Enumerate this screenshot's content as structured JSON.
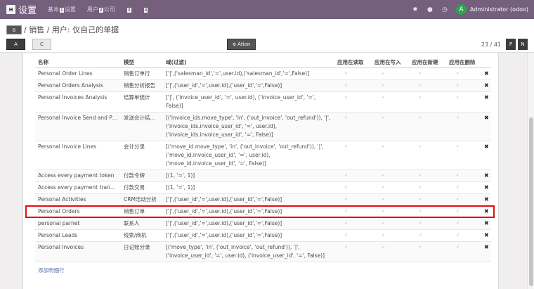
{
  "topbar": {
    "apps_label": "H",
    "brand": "设置",
    "menu": [
      {
        "pre": "基本",
        "box": "1",
        "post": "设置"
      },
      {
        "pre": "用户",
        "box": "2",
        "post": "公司"
      },
      {
        "pre": "",
        "box": "3",
        "post": ""
      },
      {
        "pre": "",
        "box": "4",
        "post": ""
      }
    ],
    "avatar_letter": "A",
    "user": "Administrator (odoo)",
    "accent": "#74607d"
  },
  "breadcrumb": {
    "back_label": "B",
    "path": "/ 销售 / 用户: 仅自己的单据"
  },
  "buttons": {
    "save": "A",
    "discard": "C",
    "action": "A",
    "action_text": "tion"
  },
  "pager": {
    "value": "23 / 41",
    "prev": "P",
    "next": "N"
  },
  "table": {
    "headers": [
      "名称",
      "模型",
      "域(过滤)",
      "应用在读取",
      "应用在写入",
      "应用在新建",
      "应用在删除"
    ],
    "rows": [
      {
        "name": "Personal Order Lines",
        "model": "销售订单行",
        "domain": "['|',('salesman_id','=',user.id),('salesman_id','=',False)]"
      },
      {
        "name": "Personal Orders Analysis",
        "model": "销售分析报告",
        "domain": "['|',('user_id','=',user.id),('user_id','=',False)]"
      },
      {
        "name": "Personal Invoices Analysis",
        "model": "结算单统计",
        "domain": "['|', ('invoice_user_id', '=', user.id), ('invoice_user_id', '=', False)]"
      },
      {
        "name": "Personal Invoice Send and Print",
        "model": "发送会计结算单",
        "domain": "[('invoice_ids.move_type', 'in', ('out_invoice', 'out_refund')), '|', ('invoice_ids.invoice_user_id', '=', user.id), ('invoice_ids.invoice_user_id', '=', False)]"
      },
      {
        "name": "Personal Invoice Lines",
        "model": "会计分录",
        "domain": "[('move_id.move_type', 'in', ('out_invoice', 'out_refund')), '|', ('move_id.invoice_user_id', '=', user.id), ('move_id.invoice_user_id', '=', False)]"
      },
      {
        "name": "Access every payment token",
        "model": "付款令牌",
        "domain": "[(1, '=', 1)]"
      },
      {
        "name": "Access every payment transacti…",
        "model": "付款交易",
        "domain": "[(1, '=', 1)]"
      },
      {
        "name": "Personal Activities",
        "model": "CRM活动分析",
        "domain": "['|',('user_id','=',user.id),('user_id','=',False)]"
      },
      {
        "name": "Personal Orders",
        "model": "销售订单",
        "domain": "['|',('user_id','=',user.id),('user_id','=',False)]"
      },
      {
        "name": "personal parnet",
        "model": "联系人",
        "domain": "['|',('user_id','=',user.id),('user_id','=',False)]"
      },
      {
        "name": "Personal Leads",
        "model": "线索/商机",
        "domain": "['|',('user_id','=',user.id),('user_id','=',False)]"
      },
      {
        "name": "Personal Invoices",
        "model": "日记账分录",
        "domain": "[('move_type', 'in', ('out_invoice', 'out_refund')), '|', ('invoice_user_id', '=', user.id), ('invoice_user_id', '=', False)]"
      }
    ],
    "check_glyph": "✓",
    "delete_glyph": "✖",
    "add_line": "添加明细行"
  }
}
